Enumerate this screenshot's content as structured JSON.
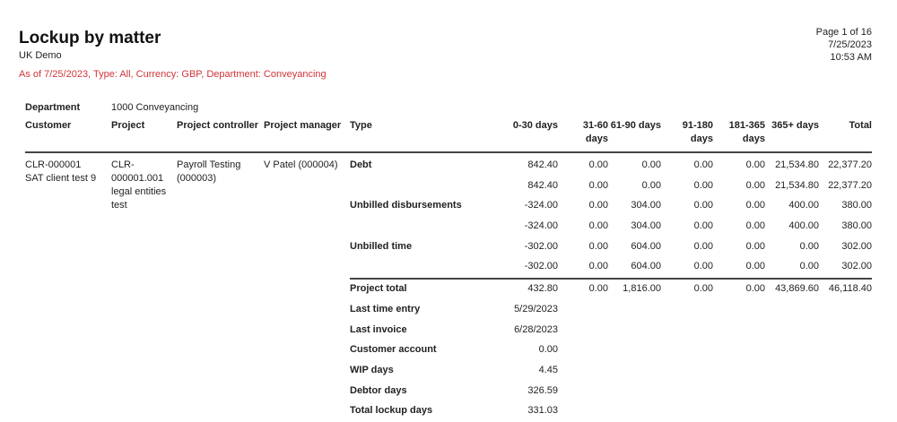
{
  "header": {
    "title": "Lockup by matter",
    "company": "UK Demo",
    "parameters": "As of 7/25/2023, Type: All, Currency: GBP, Department: Conveyancing",
    "page": "Page 1 of 16",
    "date": "7/25/2023",
    "time": "10:53 AM",
    "param_color": "#d13438"
  },
  "department": {
    "label": "Department",
    "value": "1000 Conveyancing"
  },
  "columns": {
    "customer": "Customer",
    "project": "Project",
    "controller": "Project controller",
    "manager": "Project manager",
    "type": "Type",
    "d0_30": "0-30 days",
    "d31_60": "31-60 days",
    "d61_90": "61-90 days",
    "d91_180": "91-180 days",
    "d181_365": "181-365 days",
    "d365": "365+ days",
    "total": "Total"
  },
  "record": {
    "customer_id": "CLR-000001",
    "customer_name": "SAT client test 9",
    "project_line1": "CLR-",
    "project_line2": "000001.001",
    "project_line3": "legal entities",
    "project_line4": "test",
    "controller_line1": "Payroll Testing",
    "controller_line2": "(000003)",
    "manager": "V Patel (000004)"
  },
  "rows": [
    {
      "type": "Debt",
      "values": [
        "842.40",
        "0.00",
        "0.00",
        "0.00",
        "0.00",
        "21,534.80",
        "22,377.20"
      ]
    },
    {
      "type": "",
      "values": [
        "842.40",
        "0.00",
        "0.00",
        "0.00",
        "0.00",
        "21,534.80",
        "22,377.20"
      ]
    },
    {
      "type": "Unbilled disbursements",
      "values": [
        "-324.00",
        "0.00",
        "304.00",
        "0.00",
        "0.00",
        "400.00",
        "380.00"
      ]
    },
    {
      "type": "",
      "values": [
        "-324.00",
        "0.00",
        "304.00",
        "0.00",
        "0.00",
        "400.00",
        "380.00"
      ]
    },
    {
      "type": "Unbilled time",
      "values": [
        "-302.00",
        "0.00",
        "604.00",
        "0.00",
        "0.00",
        "0.00",
        "302.00"
      ]
    },
    {
      "type": "",
      "values": [
        "-302.00",
        "0.00",
        "604.00",
        "0.00",
        "0.00",
        "0.00",
        "302.00"
      ]
    }
  ],
  "project_total": {
    "label": "Project total",
    "values": [
      "432.80",
      "0.00",
      "1,816.00",
      "0.00",
      "0.00",
      "43,869.60",
      "46,118.40"
    ]
  },
  "summary": [
    {
      "label": "Last time entry",
      "value": "5/29/2023"
    },
    {
      "label": "Last invoice",
      "value": "6/28/2023"
    },
    {
      "label": "Customer account",
      "value": "0.00"
    },
    {
      "label": "WIP days",
      "value": "4.45"
    },
    {
      "label": "Debtor days",
      "value": "326.59"
    },
    {
      "label": "Total lockup days",
      "value": "331.03"
    }
  ]
}
